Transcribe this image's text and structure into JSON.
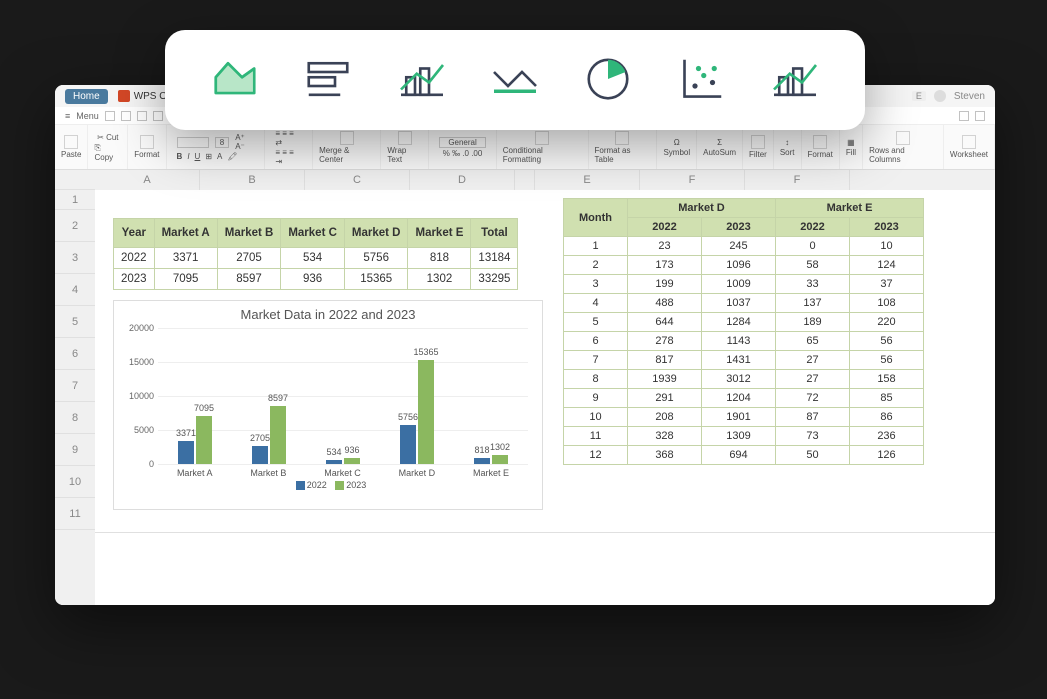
{
  "window": {
    "home_tab": "Home",
    "wps_label": "WPS O",
    "menu_label": "Menu",
    "user_name": "Steven",
    "badge": "E"
  },
  "ribbon": {
    "paste": "Paste",
    "cut": "Cut",
    "copy": "Copy",
    "format": "Format",
    "b": "B",
    "i": "I",
    "u": "U",
    "a": "A",
    "merge": "Merge & Center",
    "wrap": "Wrap Text",
    "general": "General",
    "cond_fmt": "Conditional Formatting",
    "fmt_table": "Format as Table",
    "symbol": "Symbol",
    "autosum": "AutoSum",
    "filter": "Filter",
    "sort": "Sort",
    "format2": "Format",
    "fill": "Fill",
    "rows_cols": "Rows and Columns",
    "worksheet": "Worksheet"
  },
  "col_headers": [
    "A",
    "B",
    "C",
    "D",
    "",
    "E",
    "F",
    "F"
  ],
  "row_headers": [
    "1",
    "2",
    "3",
    "4",
    "5",
    "6",
    "7",
    "8",
    "9",
    "10",
    "11"
  ],
  "yearly": {
    "headers": [
      "Year",
      "Market A",
      "Market B",
      "Market C",
      "Market D",
      "Market E",
      "Total"
    ],
    "rows": [
      [
        "2022",
        "3371",
        "2705",
        "534",
        "5756",
        "818",
        "13184"
      ],
      [
        "2023",
        "7095",
        "8597",
        "936",
        "15365",
        "1302",
        "33295"
      ]
    ]
  },
  "chart_data": {
    "type": "bar",
    "title": "Market Data in 2022 and 2023",
    "categories": [
      "Market A",
      "Market B",
      "Market C",
      "Market D",
      "Market E"
    ],
    "series": [
      {
        "name": "2022",
        "values": [
          3371,
          2705,
          534,
          5756,
          818
        ]
      },
      {
        "name": "2023",
        "values": [
          7095,
          8597,
          936,
          15365,
          1302
        ]
      }
    ],
    "ylim": [
      0,
      20000
    ],
    "yticks": [
      0,
      5000,
      10000,
      15000,
      20000
    ],
    "legend": [
      "2022",
      "2023"
    ]
  },
  "monthly": {
    "group_header": {
      "month": "Month",
      "d": "Market D",
      "e": "Market E"
    },
    "sub_headers": [
      "2022",
      "2023",
      "2022",
      "2023"
    ],
    "rows": [
      [
        "1",
        "23",
        "245",
        "0",
        "10"
      ],
      [
        "2",
        "173",
        "1096",
        "58",
        "124"
      ],
      [
        "3",
        "199",
        "1009",
        "33",
        "37"
      ],
      [
        "4",
        "488",
        "1037",
        "137",
        "108"
      ],
      [
        "5",
        "644",
        "1284",
        "189",
        "220"
      ],
      [
        "6",
        "278",
        "1143",
        "65",
        "56"
      ],
      [
        "7",
        "817",
        "1431",
        "27",
        "56"
      ],
      [
        "8",
        "1939",
        "3012",
        "27",
        "158"
      ],
      [
        "9",
        "291",
        "1204",
        "72",
        "85"
      ],
      [
        "10",
        "208",
        "1901",
        "87",
        "86"
      ],
      [
        "11",
        "328",
        "1309",
        "73",
        "236"
      ],
      [
        "12",
        "368",
        "694",
        "50",
        "126"
      ]
    ]
  },
  "chart_picker": {
    "icons": [
      "area-chart",
      "horizontal-bar-chart",
      "combo-chart",
      "line-chart",
      "pie-chart",
      "scatter-chart",
      "combo-chart-2"
    ]
  }
}
